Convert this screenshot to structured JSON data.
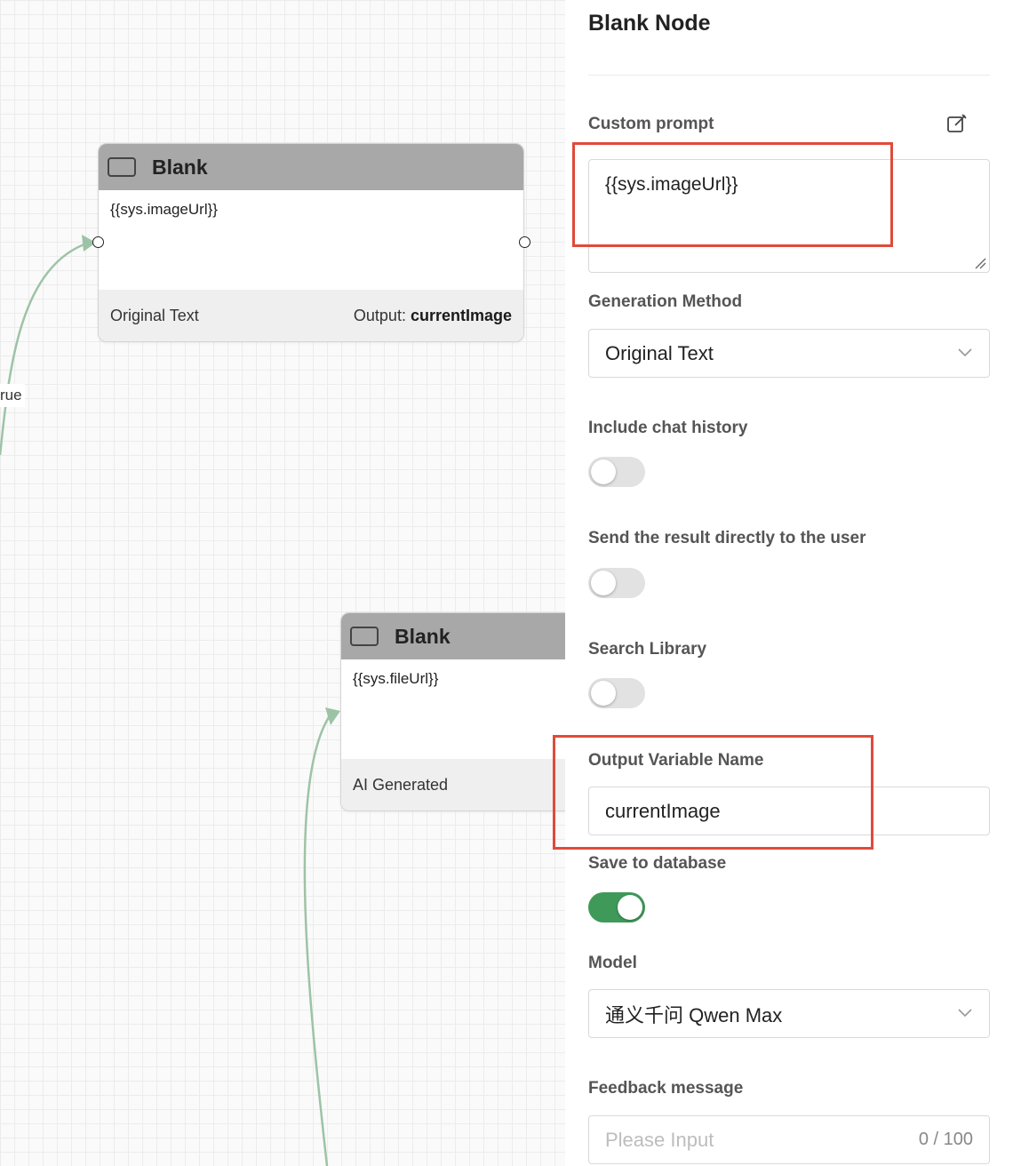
{
  "canvas": {
    "edge_label": "rue",
    "nodes": [
      {
        "title": "Blank",
        "body": "{{sys.imageUrl}}",
        "footer_left": "Original Text",
        "footer_output_prefix": "Output: ",
        "footer_output_value": "currentImage"
      },
      {
        "title": "Blank",
        "body": "{{sys.fileUrl}}",
        "footer_left": "AI Generated"
      }
    ]
  },
  "panel": {
    "title": "Blank Node",
    "custom_prompt": {
      "label": "Custom prompt",
      "value": "{{sys.imageUrl}}",
      "edit_icon": "edit-icon"
    },
    "generation_method": {
      "label": "Generation Method",
      "value": "Original Text"
    },
    "include_chat_history": {
      "label": "Include chat history",
      "on": false
    },
    "send_result": {
      "label": "Send the result directly to the user",
      "on": false
    },
    "search_library": {
      "label": "Search Library",
      "on": false
    },
    "output_variable": {
      "label": "Output Variable Name",
      "value": "currentImage"
    },
    "save_to_database": {
      "label": "Save to database",
      "on": true
    },
    "model": {
      "label": "Model",
      "value": "通义千问 Qwen Max"
    },
    "feedback": {
      "label": "Feedback message",
      "placeholder": "Please Input",
      "counter": "0 / 100"
    }
  },
  "colors": {
    "edge": "#9dc3a6",
    "toggle_on": "#3f9a5a",
    "highlight": "#e04a3a",
    "node_header": "#a8a8a8"
  }
}
